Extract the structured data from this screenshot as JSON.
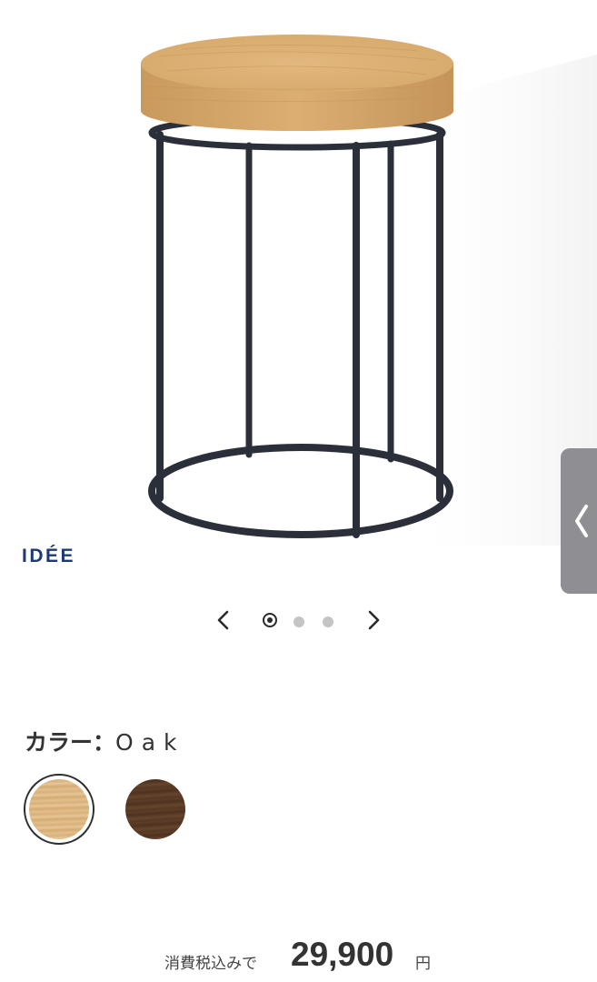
{
  "product": {
    "image_alt": "Round oak side table with black steel frame",
    "brand": "IDÉE",
    "top_color": "#d9ac6f",
    "frame_color": "#2b2f3a"
  },
  "carousel": {
    "prev_icon": "chevron-left-icon",
    "next_icon": "chevron-right-icon",
    "total_dots": 3,
    "active_index": 0
  },
  "side_tab": {
    "icon": "chevron-left-icon"
  },
  "color": {
    "label": "カラー：",
    "selected": "Oak",
    "options": [
      {
        "name": "Oak",
        "hex": "#dcb987"
      },
      {
        "name": "Walnut",
        "hex": "#5a3b26"
      }
    ]
  },
  "price": {
    "tax_label": "消費税込みで",
    "value": "29,900",
    "currency": "円"
  }
}
